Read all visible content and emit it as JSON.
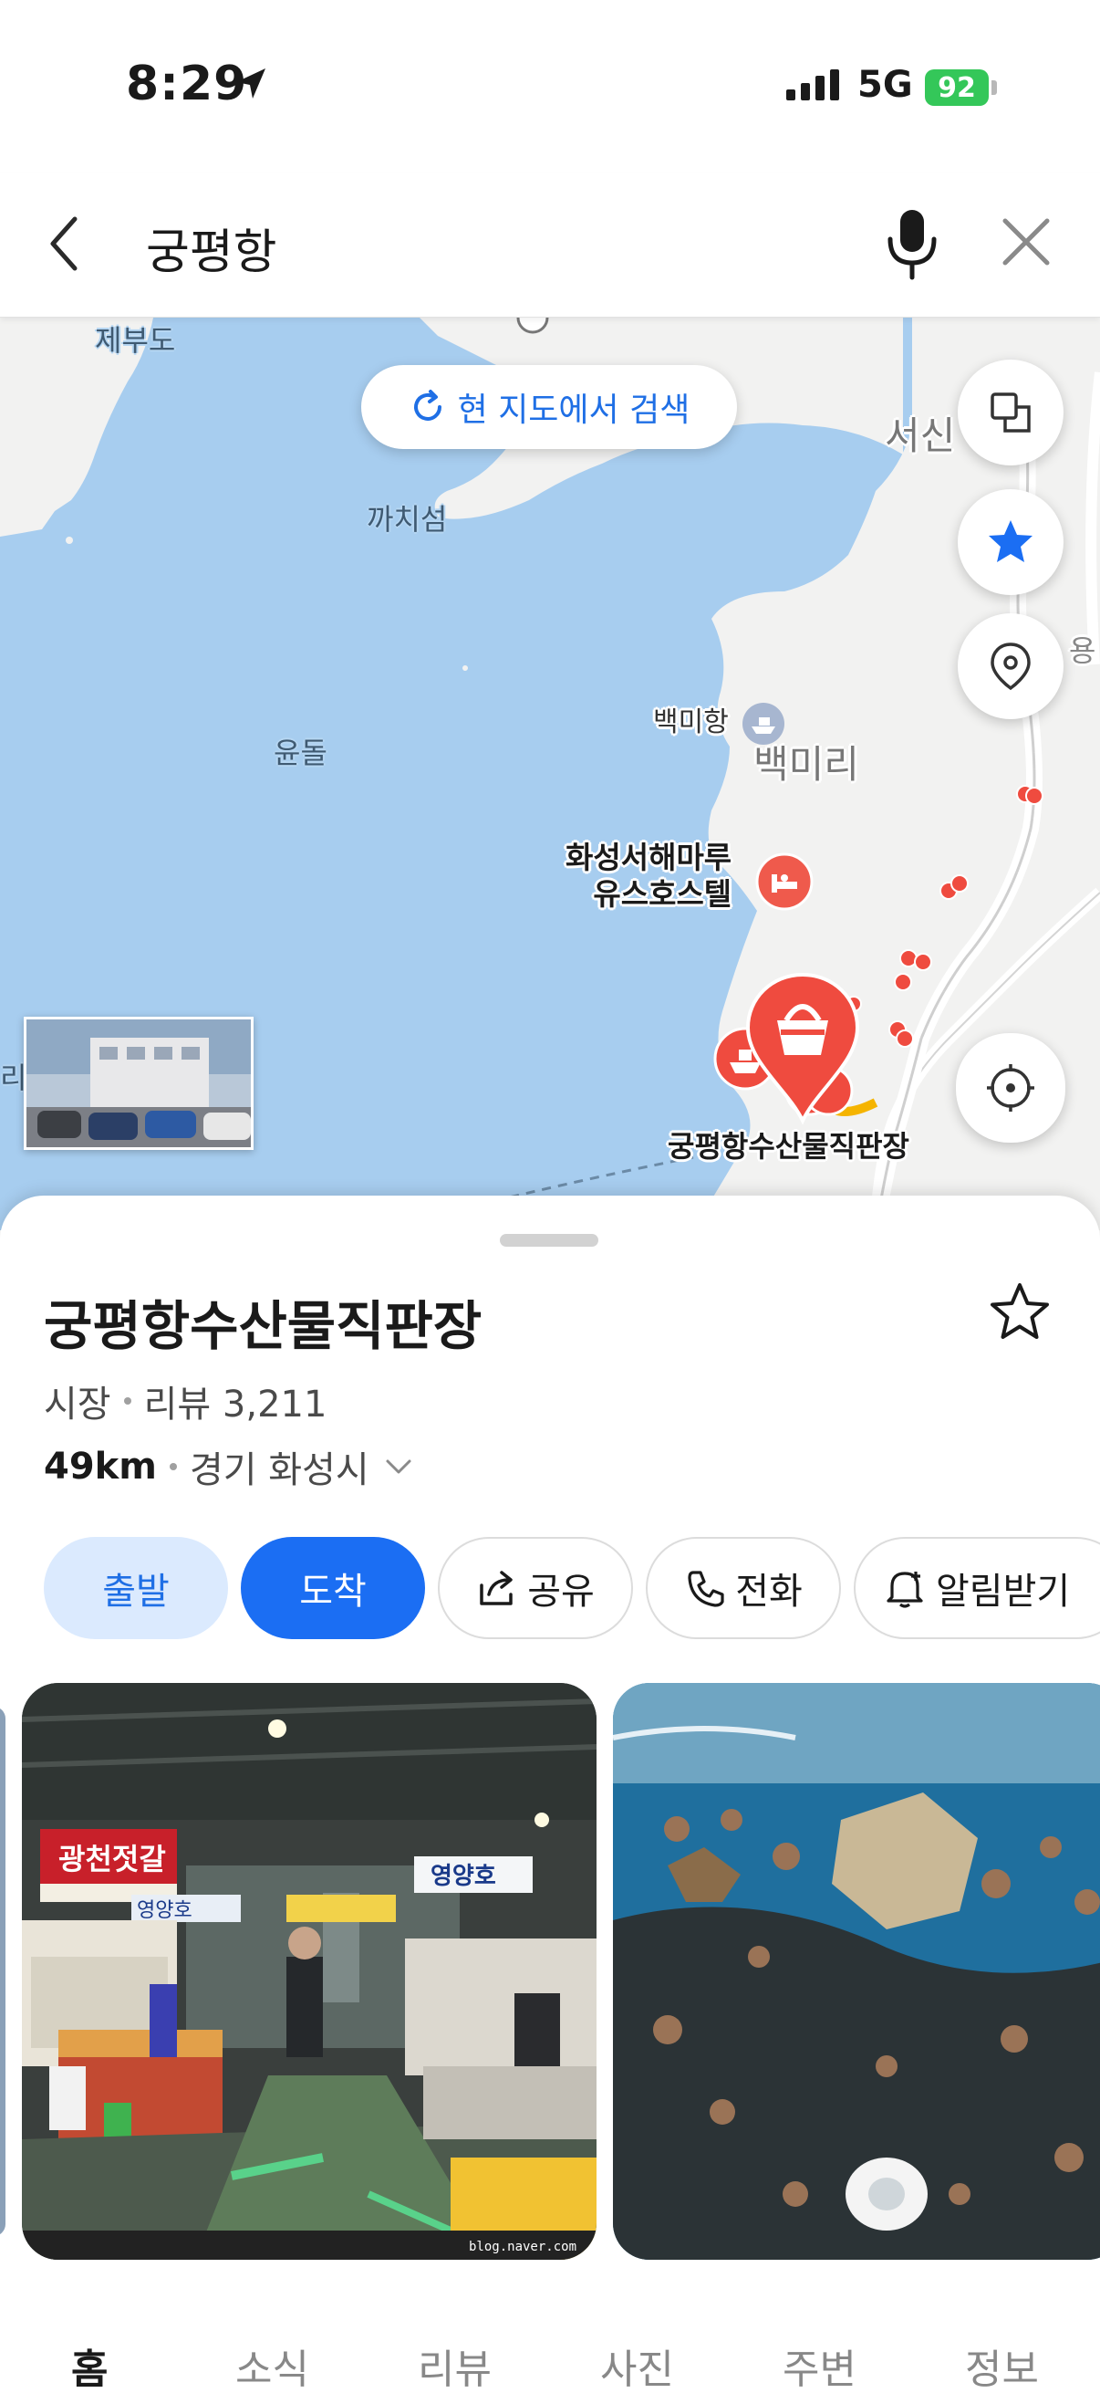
{
  "status_bar": {
    "time": "8:29",
    "network": "5G",
    "battery": "92"
  },
  "search": {
    "query": "궁평항"
  },
  "map": {
    "research_button": "현 지도에서 검색",
    "labels": {
      "jebudo": "제부도",
      "kkachiseom": "까치섬",
      "yundol": "윤돌",
      "baekmiri": "백미리",
      "seosin": "서신",
      "yong": "용",
      "left_edge": "리"
    },
    "pois": {
      "baekmihang": "백미항",
      "hostel_line1": "화성서해마루",
      "hostel_line2": "유스호스텔",
      "selected": "궁평항수산물직판장"
    },
    "colors": {
      "water": "#a7cdef",
      "land": "#f2f2f1",
      "poi_red": "#ef4b3f",
      "accent_blue": "#1f6fe5"
    }
  },
  "place": {
    "name": "궁평항수산물직판장",
    "category": "시장",
    "reviews": "리뷰 3,211",
    "distance": "49km",
    "region": "경기 화성시"
  },
  "actions": {
    "depart": "출발",
    "arrive": "도착",
    "share": "공유",
    "call": "전화",
    "notify": "알림받기"
  },
  "photos": {
    "sign_main": "광천젓갈",
    "sign_boat": "영양호",
    "sign_left": "영양호",
    "watermark": "blog.naver.com"
  },
  "tabs": {
    "home": "홈",
    "news": "소식",
    "review": "리뷰",
    "photo": "사진",
    "nearby": "주변",
    "info": "정보"
  }
}
